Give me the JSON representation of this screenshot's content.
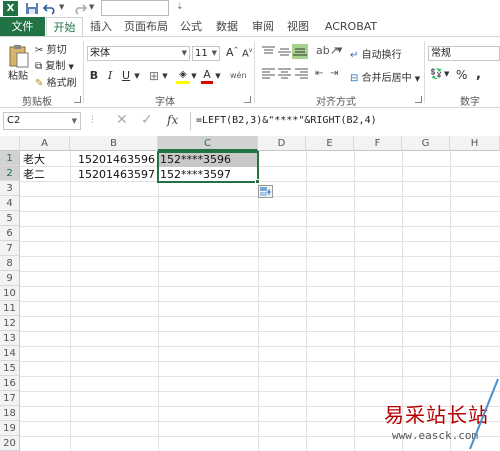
{
  "titlebar": {
    "app_icon": "X",
    "name_box_value": ""
  },
  "tabs": [
    "文件",
    "开始",
    "插入",
    "页面布局",
    "公式",
    "数据",
    "审阅",
    "视图",
    "ACROBAT"
  ],
  "ribbon": {
    "clipboard": {
      "paste": "粘贴",
      "cut": "剪切",
      "copy": "复制",
      "format_painter": "格式刷",
      "label": "剪贴板"
    },
    "font": {
      "name": "宋体",
      "size": "11",
      "grow": "A",
      "shrink": "A",
      "bold": "B",
      "italic": "I",
      "underline": "U",
      "font_color": "A",
      "wen": "wén",
      "label": "字体"
    },
    "alignment": {
      "wrap": "自动换行",
      "merge": "合并后居中",
      "label": "对齐方式"
    },
    "number": {
      "format": "常规",
      "percent": "%",
      "comma": ",",
      "label": "数字"
    }
  },
  "formula_bar": {
    "cell_ref": "C2",
    "fx": "fx",
    "formula": "=LEFT(B2,3)&\"****\"&RIGHT(B2,4)"
  },
  "columns": [
    "A",
    "B",
    "C",
    "D",
    "E",
    "F",
    "G",
    "H"
  ],
  "rows": [
    "1",
    "2",
    "3",
    "4",
    "5",
    "6",
    "7",
    "8",
    "9",
    "10",
    "11",
    "12",
    "13",
    "14",
    "15",
    "16",
    "17",
    "18",
    "19",
    "20"
  ],
  "cells": {
    "A1": "老大",
    "B1": "15201463596",
    "C1": "152****3596",
    "A2": "老二",
    "B2": "15201463597",
    "C2": "152****3597"
  },
  "watermark": {
    "title": "易采站长站",
    "url": "www.easck.com"
  }
}
